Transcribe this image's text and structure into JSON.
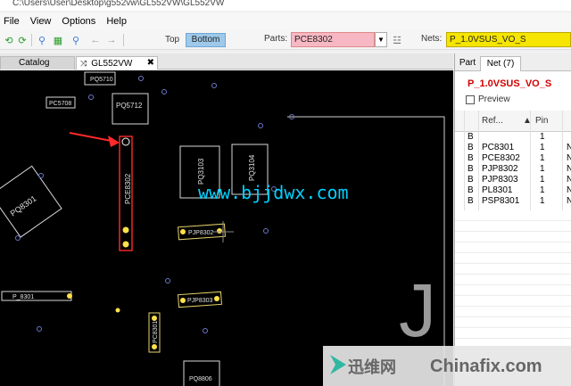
{
  "window": {
    "title": "C:\\Users\\User\\Desktop\\g552vw\\GL552VW\\GL552VW"
  },
  "menu": {
    "file": "File",
    "view": "View",
    "options": "Options",
    "help": "Help"
  },
  "toolbar": {
    "top_label": "Top",
    "bottom_label": "Bottom",
    "parts_label": "Parts:",
    "parts_value": "PCE8302",
    "nets_label": "Nets:",
    "nets_value": "P_1.0VSUS_VO_S"
  },
  "tabs": {
    "catalog": "Catalog",
    "board": "GL552VW"
  },
  "panel": {
    "tab_part": "Part",
    "tab_net": "Net (7)",
    "net_title": "P_1.0VSUS_VO_S",
    "preview_label": "Preview",
    "columns": {
      "ref": "Ref...",
      "pin": "Pin"
    },
    "rows": [
      {
        "side": "B",
        "ref": "",
        "pin": "1",
        "extra": ""
      },
      {
        "side": "B",
        "ref": "PC8301",
        "pin": "1",
        "extra": "N"
      },
      {
        "side": "B",
        "ref": "PCE8302",
        "pin": "1",
        "extra": "N"
      },
      {
        "side": "B",
        "ref": "PJP8302",
        "pin": "1",
        "extra": "N"
      },
      {
        "side": "B",
        "ref": "PJP8303",
        "pin": "1",
        "extra": "N"
      },
      {
        "side": "B",
        "ref": "PL8301",
        "pin": "1",
        "extra": "N"
      },
      {
        "side": "B",
        "ref": "PSP8301",
        "pin": "1",
        "extra": "N"
      }
    ]
  },
  "board": {
    "labels": {
      "pq5710": "PQ5710",
      "pq5712": "PQ5712",
      "pc5708": "PC5708",
      "pq8301": "PQ8301",
      "pce8302": "PCE8302",
      "pq3103": "PQ3103",
      "pq3104": "PQ3104",
      "pjp8302": "PJP8302",
      "pjp8303": "PJP8303",
      "pl8301": "P_8301",
      "pc8301": "PC8301",
      "pq8806": "PQ8806",
      "big_letter": "J"
    }
  },
  "watermark": {
    "site": "www.bjjdwx.com",
    "cn": "迅维网",
    "en": "Chinafix.com"
  },
  "colors": {
    "canvas": "#000000",
    "highlight": "#ff2a2a",
    "parts_field": "#f7b8c4",
    "nets_field": "#f5e500",
    "bottom_btn": "#9ec9ea",
    "net_title": "#d10000",
    "watermark": "#00d0ff"
  }
}
